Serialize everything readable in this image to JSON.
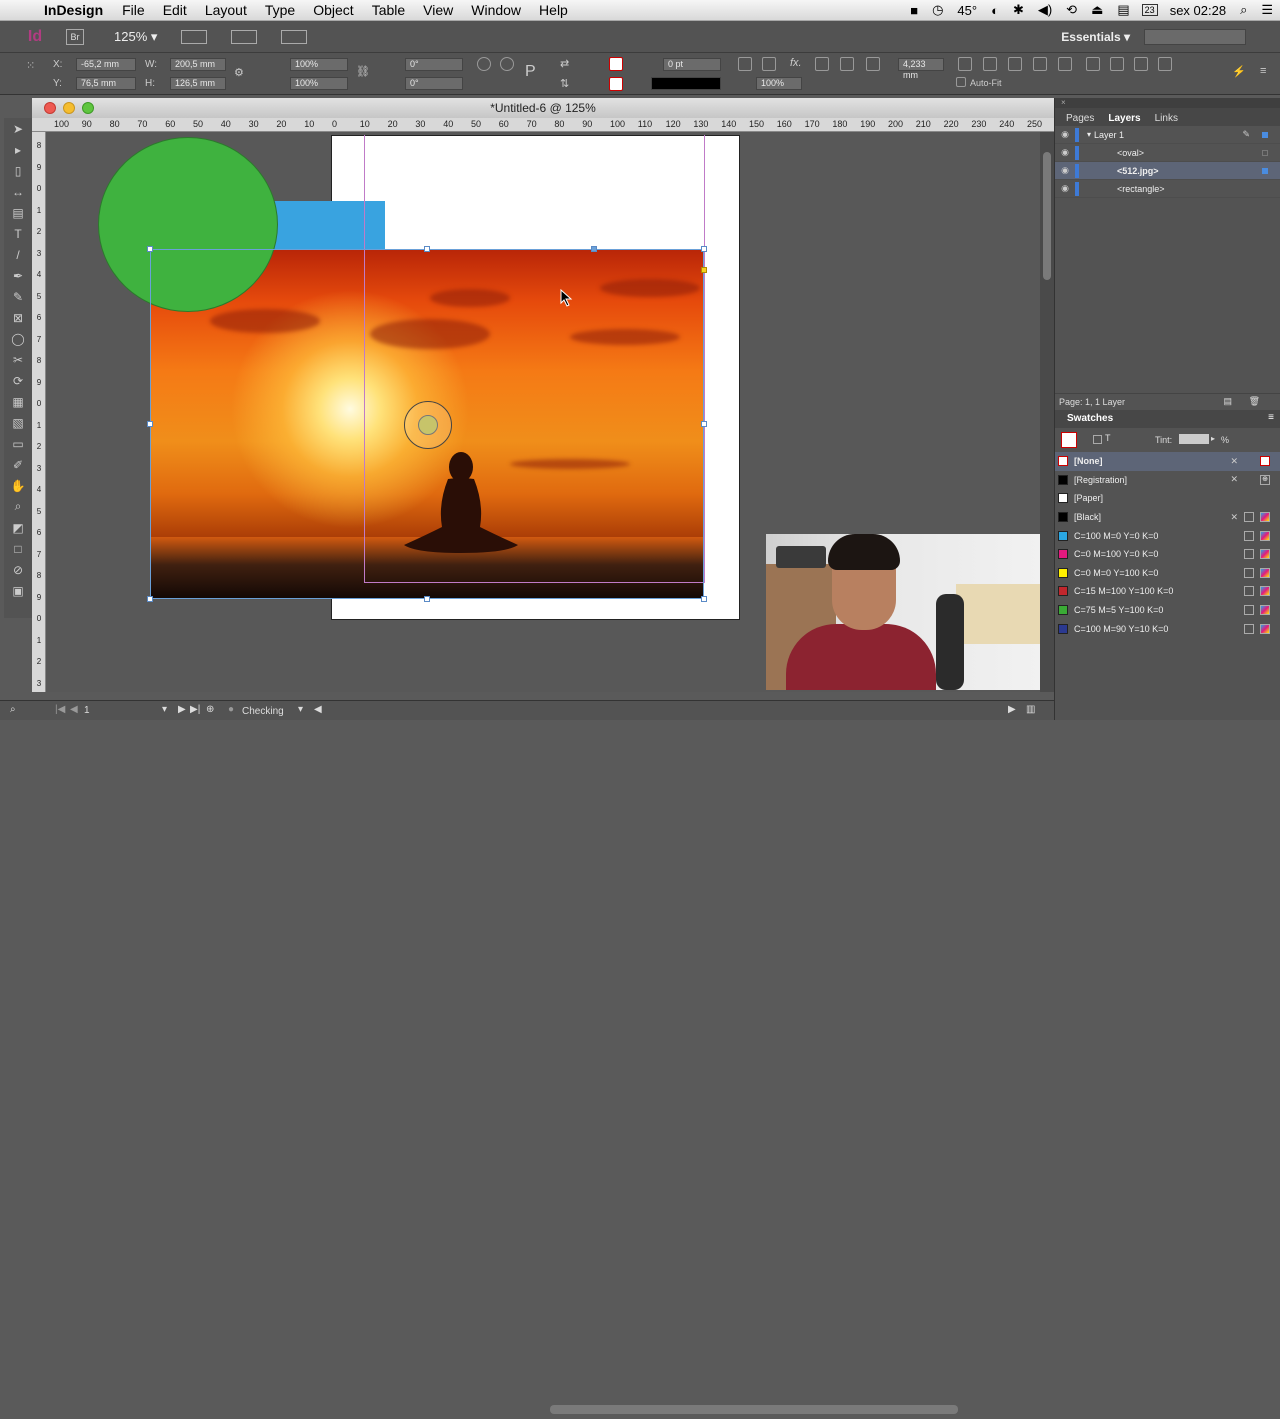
{
  "menubar": {
    "app_name": "InDesign",
    "items": [
      "File",
      "Edit",
      "Layout",
      "Type",
      "Object",
      "Table",
      "View",
      "Window",
      "Help"
    ],
    "angle_indicator": "45°",
    "calendar_day": "23",
    "clock": "sex 02:28"
  },
  "appbar": {
    "app_logo": "Id",
    "bridge_label": "Br",
    "zoom": "125%",
    "workspace": "Essentials"
  },
  "control": {
    "x_label": "X:",
    "x_value": "-65,2 mm",
    "y_label": "Y:",
    "y_value": "76,5 mm",
    "w_label": "W:",
    "w_value": "200,5 mm",
    "h_label": "H:",
    "h_value": "126,5 mm",
    "scale_x": "100%",
    "scale_y": "100%",
    "rotate": "0°",
    "shear": "0°",
    "stroke_weight": "0 pt",
    "opacity": "100%",
    "gap": "4,233 mm",
    "autofit_label": "Auto-Fit"
  },
  "document": {
    "title": "*Untitled-6 @ 125%",
    "hruler_ticks": [
      "100",
      "90",
      "80",
      "70",
      "60",
      "50",
      "40",
      "30",
      "20",
      "10",
      "0",
      "10",
      "20",
      "30",
      "40",
      "50",
      "60",
      "70",
      "80",
      "90",
      "100",
      "110",
      "120",
      "130",
      "140",
      "150",
      "160",
      "170",
      "180",
      "190",
      "200",
      "210",
      "220",
      "230",
      "240",
      "250"
    ],
    "vruler_ticks": [
      "8",
      "9",
      "0",
      "1",
      "2",
      "3",
      "4",
      "5",
      "6",
      "7",
      "8",
      "9",
      "0",
      "1",
      "2",
      "3",
      "4",
      "5",
      "6",
      "7",
      "8",
      "9",
      "0",
      "1",
      "2",
      "3"
    ]
  },
  "status": {
    "page": "1",
    "preflight": "Checking"
  },
  "layers_panel": {
    "tabs": [
      "Pages",
      "Layers",
      "Links"
    ],
    "active_tab": "Layers",
    "layers": [
      {
        "name": "Layer 1",
        "level": 0
      },
      {
        "name": "<oval>",
        "level": 1
      },
      {
        "name": "<512.jpg>",
        "level": 1,
        "selected": true
      },
      {
        "name": "<rectangle>",
        "level": 1
      }
    ],
    "footer": "Page: 1, 1 Layer"
  },
  "swatches_panel": {
    "title": "Swatches",
    "tint_label": "Tint:",
    "tint_unit": "%",
    "swatches": [
      {
        "name": "[None]",
        "color": "#ffffff",
        "selected": true
      },
      {
        "name": "[Registration]",
        "color": "#000000"
      },
      {
        "name": "[Paper]",
        "color": "#ffffff"
      },
      {
        "name": "[Black]",
        "color": "#000000"
      },
      {
        "name": "C=100 M=0 Y=0 K=0",
        "color": "#2aa7e3"
      },
      {
        "name": "C=0 M=100 Y=0 K=0",
        "color": "#e3197e"
      },
      {
        "name": "C=0 M=0 Y=100 K=0",
        "color": "#fff000"
      },
      {
        "name": "C=15 M=100 Y=100 K=0",
        "color": "#c1272d"
      },
      {
        "name": "C=75 M=5 Y=100 K=0",
        "color": "#3aaa35"
      },
      {
        "name": "C=100 M=90 Y=10 K=0",
        "color": "#2b3990"
      }
    ]
  },
  "colors": {
    "oval_fill": "#3fb23f",
    "rectangle_fill": "#39a3e0",
    "selection": "#6aa0d8",
    "margin_guide": "#c07bc8"
  }
}
